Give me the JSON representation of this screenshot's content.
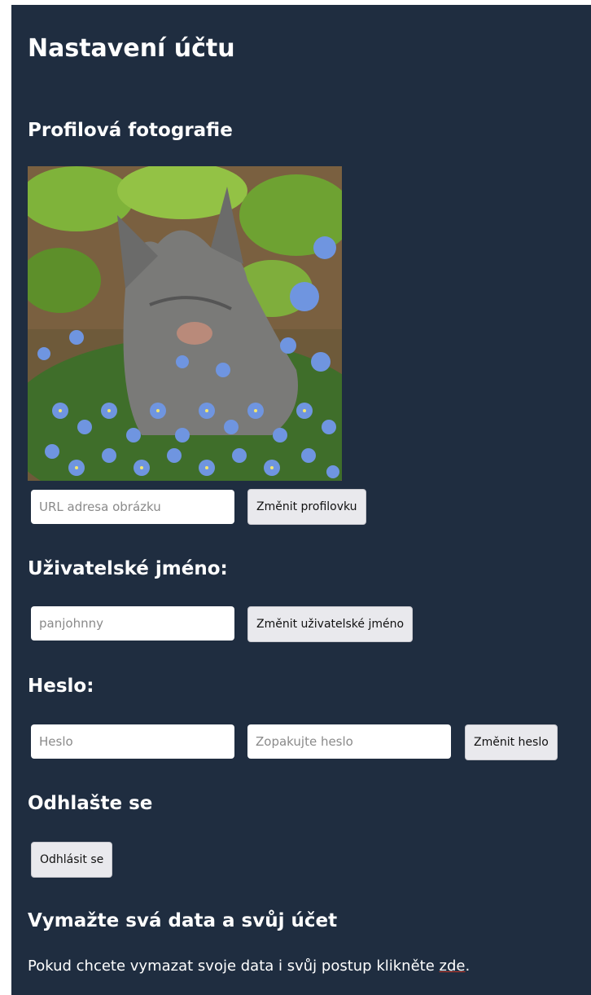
{
  "page": {
    "title": "Nastavení účtu"
  },
  "profile_photo": {
    "heading": "Profilová fotografie",
    "url_placeholder": "URL adresa obrázku",
    "change_button": "Změnit profilovku"
  },
  "username": {
    "heading": "Uživatelské jméno:",
    "value_placeholder": "panjohnny",
    "change_button": "Změnit uživatelské jméno"
  },
  "password": {
    "heading": "Heslo:",
    "password_placeholder": "Heslo",
    "repeat_placeholder": "Zopakujte heslo",
    "change_button": "Změnit heslo"
  },
  "logout": {
    "heading": "Odhlašte se",
    "button": "Odhlásit se"
  },
  "delete_account": {
    "heading": "Vymažte svá data a svůj účet",
    "text": "Pokud chcete vymazat svoje data i svůj postup klikněte ",
    "link": "zde",
    "trailing": "."
  },
  "colors": {
    "background": "#1f2d40",
    "text": "#ffffff",
    "button": "#e9e9ed"
  }
}
